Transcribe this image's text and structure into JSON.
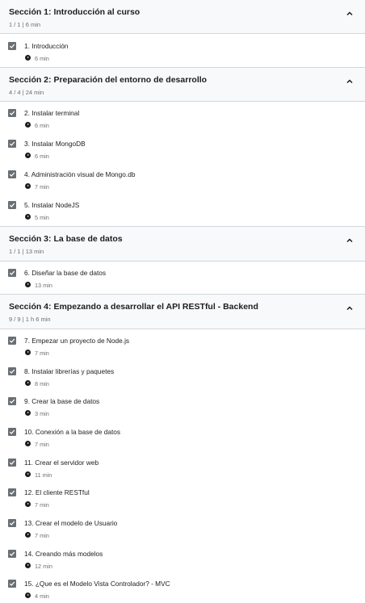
{
  "sections": [
    {
      "title": "Sección 1: Introducción al curso",
      "meta": "1 / 1 | 6 min",
      "lessons": [
        {
          "title": "1. Introducción",
          "duration": "6 min"
        }
      ]
    },
    {
      "title": "Sección 2: Preparación del entorno de desarrollo",
      "meta": "4 / 4 | 24 min",
      "lessons": [
        {
          "title": "2. Instalar terminal",
          "duration": "6 min"
        },
        {
          "title": "3. Instalar MongoDB",
          "duration": "6 min"
        },
        {
          "title": "4. Administración visual de Mongo.db",
          "duration": "7 min"
        },
        {
          "title": "5. Instalar NodeJS",
          "duration": "5 min"
        }
      ]
    },
    {
      "title": "Sección 3: La base de datos",
      "meta": "1 / 1 | 13 min",
      "lessons": [
        {
          "title": "6. Diseñar la base de datos",
          "duration": "13 min"
        }
      ]
    },
    {
      "title": "Sección 4: Empezando a desarrollar el API RESTful - Backend",
      "meta": "9 / 9 | 1 h 6 min",
      "lessons": [
        {
          "title": "7. Empezar un proyecto de Node.js",
          "duration": "7 min"
        },
        {
          "title": "8. Instalar librerías y paquetes",
          "duration": "8 min"
        },
        {
          "title": "9. Crear la base de datos",
          "duration": "3 min"
        },
        {
          "title": "10. Conexión a la base de datos",
          "duration": "7 min"
        },
        {
          "title": "11. Crear el servidor web",
          "duration": "11 min"
        },
        {
          "title": "12. El cliente RESTful",
          "duration": "7 min"
        },
        {
          "title": "13. Crear el modelo de Usuario",
          "duration": "7 min"
        },
        {
          "title": "14. Creando más modelos",
          "duration": "12 min"
        },
        {
          "title": "15. ¿Que es el Modelo Vista Controlador? - MVC",
          "duration": "4 min"
        }
      ]
    }
  ]
}
